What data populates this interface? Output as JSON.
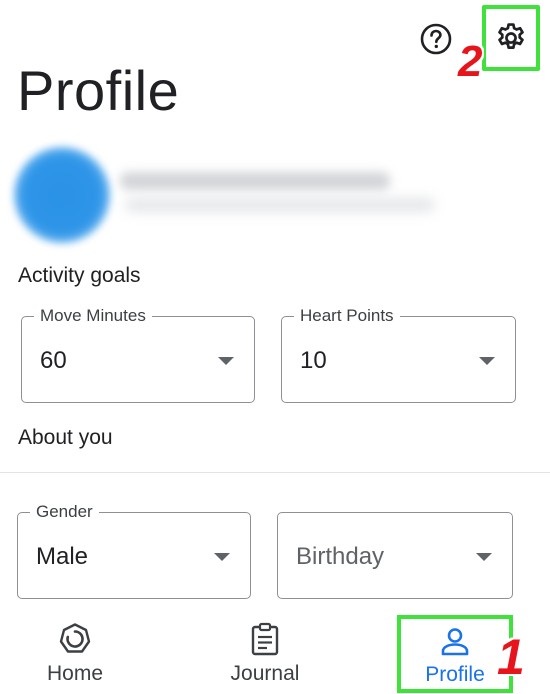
{
  "header": {
    "title": "Profile",
    "help_icon": "help-circle-icon",
    "settings_icon": "gear-icon"
  },
  "annotations": {
    "settings_step": "2",
    "profile_step": "1",
    "highlight_color": "#3ee23a",
    "number_color": "#e8141b"
  },
  "activity_goals": {
    "heading": "Activity goals",
    "move_minutes": {
      "label": "Move Minutes",
      "value": "60"
    },
    "heart_points": {
      "label": "Heart Points",
      "value": "10"
    }
  },
  "about_you": {
    "heading": "About you",
    "gender": {
      "label": "Gender",
      "value": "Male"
    },
    "birthday": {
      "placeholder": "Birthday"
    }
  },
  "bottom_nav": {
    "items": [
      {
        "label": "Home",
        "icon": "home-ring-icon"
      },
      {
        "label": "Journal",
        "icon": "clipboard-icon"
      },
      {
        "label": "Profile",
        "icon": "person-icon",
        "active": true
      }
    ],
    "active_color": "#1a73e8"
  }
}
